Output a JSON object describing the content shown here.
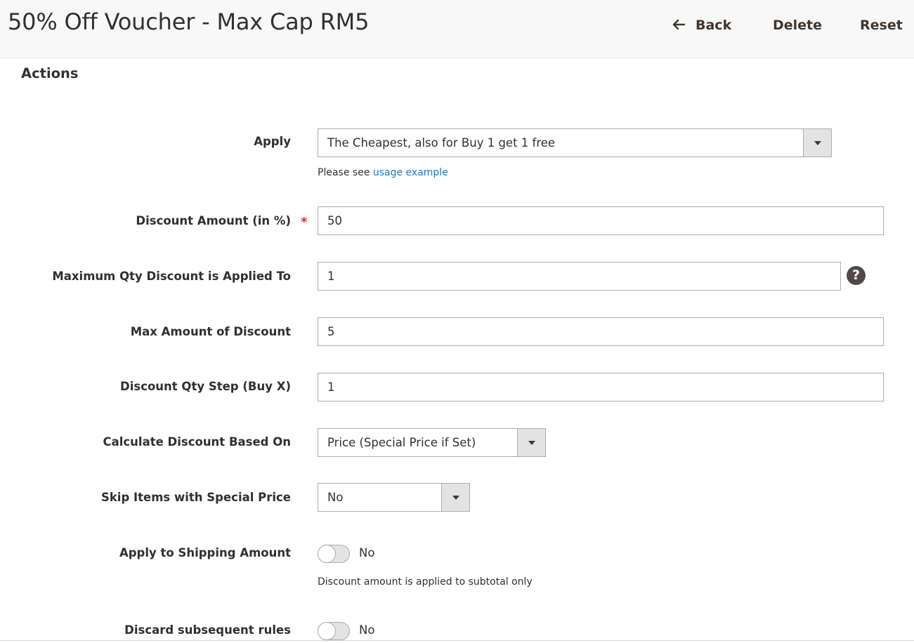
{
  "header": {
    "title": "50% Off Voucher - Max Cap RM5",
    "back_label": "Back",
    "delete_label": "Delete",
    "reset_label": "Reset"
  },
  "section": {
    "title": "Actions"
  },
  "form": {
    "apply": {
      "label": "Apply",
      "value": "The Cheapest, also for Buy 1 get 1 free",
      "note_prefix": "Please see",
      "note_link": "usage example"
    },
    "discount_amount": {
      "label": "Discount Amount (in %)",
      "required_mark": "*",
      "value": "50"
    },
    "max_qty": {
      "label": "Maximum Qty Discount is Applied To",
      "value": "1",
      "help_icon": "?"
    },
    "max_amount": {
      "label": "Max Amount of Discount",
      "value": "5"
    },
    "qty_step": {
      "label": "Discount Qty Step (Buy X)",
      "value": "1"
    },
    "calc_based_on": {
      "label": "Calculate Discount Based On",
      "value": "Price (Special Price if Set)"
    },
    "skip_special": {
      "label": "Skip Items with Special Price",
      "value": "No"
    },
    "apply_shipping": {
      "label": "Apply to Shipping Amount",
      "state": "No",
      "note": "Discount amount is applied to subtotal only"
    },
    "discard_rules": {
      "label": "Discard subsequent rules",
      "state": "No"
    }
  },
  "colors": {
    "header_bg": "#f8f8f8",
    "link": "#1979c3",
    "required": "#e22626",
    "border": "#adadad",
    "select_arrow_bg": "#e3e3e3"
  }
}
